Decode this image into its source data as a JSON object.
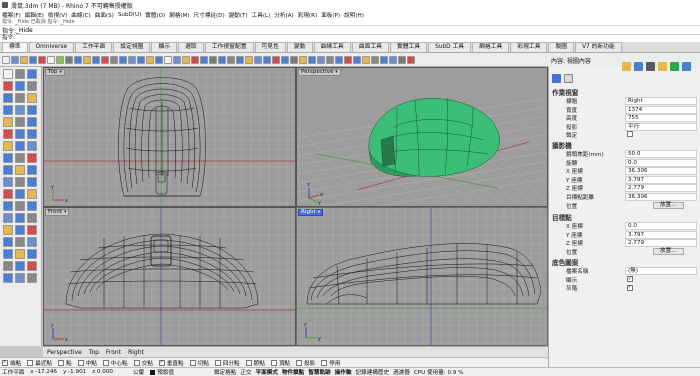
{
  "window": {
    "title": "滑鼠.3dm (7 MB) - Rhino 7 不可轉售授權版"
  },
  "menu": [
    "檔案(F)",
    "編輯(E)",
    "檢視(V)",
    "曲線(C)",
    "曲面(S)",
    "SubD(U)",
    "實體(O)",
    "網格(M)",
    "尺寸標註(D)",
    "變動(T)",
    "工具(L)",
    "分析(A)",
    "彩現(R)",
    "面板(P)",
    "說明(H)"
  ],
  "command": {
    "history": "指令: _Hide   已取消   指令: _Hide",
    "prompt_label": "指令:",
    "value": "_Hide",
    "sub": "指令:"
  },
  "tabs": [
    "標準",
    "Omniverse",
    "工作平面",
    "設定視圖",
    "顯示",
    "選取",
    "工作視窗配置",
    "可見性",
    "變動",
    "曲線工具",
    "曲面工具",
    "實體工具",
    "SubD 工具",
    "網格工具",
    "彩現工具",
    "製圖",
    "V7 的新功能"
  ],
  "viewports": {
    "top": {
      "title": "Top"
    },
    "perspective": {
      "title": "Perspective"
    },
    "front": {
      "title": "Front"
    },
    "right": {
      "title": "Right"
    }
  },
  "viewport_tabs": [
    "Perspective",
    "Top",
    "Front",
    "Right"
  ],
  "osnaps": [
    {
      "label": "端點",
      "checked": true
    },
    {
      "label": "最近點",
      "checked": false
    },
    {
      "label": "點",
      "checked": false
    },
    {
      "label": "中點",
      "checked": false
    },
    {
      "label": "中心點",
      "checked": false
    },
    {
      "label": "交點",
      "checked": false
    },
    {
      "label": "垂直點",
      "checked": true
    },
    {
      "label": "切點",
      "checked": false
    },
    {
      "label": "四分點",
      "checked": false
    },
    {
      "label": "節點",
      "checked": false
    },
    {
      "label": "頂點",
      "checked": false
    },
    {
      "label": "投影",
      "checked": false
    },
    {
      "label": "停用",
      "checked": false
    }
  ],
  "status": {
    "plane": "工作平面",
    "x": "x -17.246",
    "y": "y -1.901",
    "z": "z 0.000",
    "units": "公釐",
    "layer": "預設值",
    "items": [
      "鎖定格點",
      "正交",
      "平面模式",
      "物件鎖點",
      "智慧軌跡",
      "操作軸",
      "記錄建構歷史",
      "過濾器",
      "CPU 使用量: 0.9 %"
    ]
  },
  "panel": {
    "title": "內容: 視圖內容",
    "section_viewport": "作業視窗",
    "fields_viewport": [
      {
        "label": "標題",
        "value": "Right"
      },
      {
        "label": "寬度",
        "value": "1374"
      },
      {
        "label": "高度",
        "value": "755"
      },
      {
        "label": "投影",
        "value": "平行"
      },
      {
        "label": "鎖定",
        "value": ""
      }
    ],
    "section_camera": "攝影機",
    "fields_camera": [
      {
        "label": "鏡頭焦距(mm)",
        "value": "50.0"
      },
      {
        "label": "旋轉",
        "value": "0.0"
      },
      {
        "label": "X 座標",
        "value": "36.306"
      },
      {
        "label": "Y 座標",
        "value": "3.797"
      },
      {
        "label": "Z 座標",
        "value": "2.779"
      },
      {
        "label": "目標點距離",
        "value": "36.306"
      },
      {
        "label": "位置",
        "value": "放置..."
      }
    ],
    "section_target": "目標點",
    "fields_target": [
      {
        "label": "X 座標",
        "value": "0.0"
      },
      {
        "label": "Y 座標",
        "value": "3.797"
      },
      {
        "label": "Z 座標",
        "value": "2.779"
      },
      {
        "label": "位置",
        "value": "放置..."
      }
    ],
    "section_wallpaper": "底色圖案",
    "fields_wallpaper": [
      {
        "label": "檔案名稱",
        "value": "(無)"
      },
      {
        "label": "顯示",
        "value": ""
      },
      {
        "label": "灰階",
        "value": ""
      }
    ]
  },
  "colors": {
    "model_green": "#3bbf77",
    "grid_bg": "#9d9d9d",
    "active_viewport": "#4a6ed6"
  }
}
